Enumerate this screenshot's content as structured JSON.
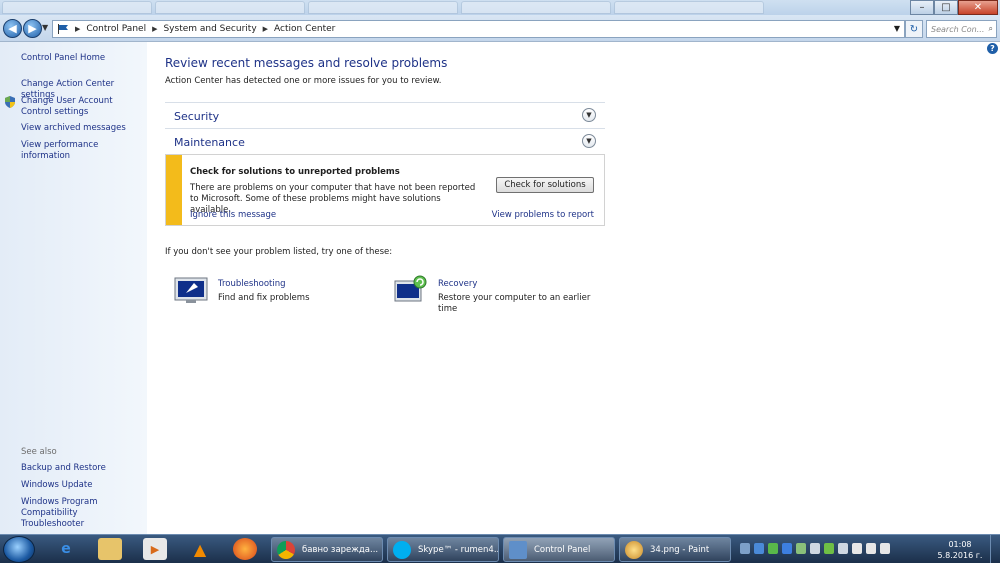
{
  "window": {
    "minimize_label": "–",
    "maximize_label": "□",
    "close_label": "✕"
  },
  "address": {
    "crumbs": [
      "Control Panel",
      "System and Security",
      "Action Center"
    ],
    "search_placeholder": "Search Con...",
    "back_symbol": "◀",
    "forward_symbol": "▶",
    "refresh_symbol": "↻",
    "search_symbol": "⌕"
  },
  "sidebar": {
    "home": "Control Panel Home",
    "links": [
      "Change Action Center settings",
      "Change User Account Control settings",
      "View archived messages",
      "View performance information"
    ],
    "see_also_label": "See also",
    "see_also": [
      "Backup and Restore",
      "Windows Update",
      "Windows Program Compatibility Troubleshooter"
    ]
  },
  "main": {
    "title": "Review recent messages and resolve problems",
    "subtitle": "Action Center has detected one or more issues for you to review.",
    "sections": [
      "Security",
      "Maintenance"
    ],
    "alert": {
      "title": "Check for solutions to unreported problems",
      "body": "There are problems on your computer that have not been reported to Microsoft. Some of these problems might have solutions available.",
      "button": "Check for solutions",
      "ignore": "Ignore this message",
      "view": "View problems to report"
    },
    "try_text": "If you don't see your problem listed, try one of these:",
    "tools": [
      {
        "title": "Troubleshooting",
        "desc": "Find and fix problems"
      },
      {
        "title": "Recovery",
        "desc": "Restore your computer to an earlier time"
      }
    ]
  },
  "taskbar": {
    "items": [
      {
        "label": "бавно зарежда...",
        "icon": "chrome-icon"
      },
      {
        "label": "Skype™ - rumen4...",
        "icon": "skype-icon"
      },
      {
        "label": "Control Panel",
        "icon": "control-panel-icon"
      },
      {
        "label": "34.png - Paint",
        "icon": "paint-icon"
      }
    ],
    "time": "01:08",
    "date": "5.8.2016 г.",
    "colors": {
      "accent": "#1e3287",
      "warning": "#f3bb1b",
      "taskbar": "#1b2f4a"
    }
  }
}
